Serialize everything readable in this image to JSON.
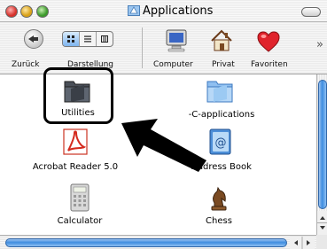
{
  "window": {
    "title": "Applications"
  },
  "toolbar": {
    "back_label": "Zurück",
    "view_label": "Darstellung",
    "computer_label": "Computer",
    "home_label": "Privat",
    "favorites_label": "Favoriten",
    "more_glyph": "»"
  },
  "items": [
    {
      "label": "Utilities",
      "icon": "folder-icon"
    },
    {
      "label": "-C-applications",
      "icon": "folder-icon"
    },
    {
      "label": "Acrobat Reader 5.0",
      "icon": "acrobat-icon"
    },
    {
      "label": "Address Book",
      "icon": "address-book-icon"
    },
    {
      "label": "Calculator",
      "icon": "calculator-icon"
    },
    {
      "label": "Chess",
      "icon": "chess-icon"
    }
  ],
  "colors": {
    "selection_accent": "#3f8de0",
    "highlight_border": "#000000",
    "folder_blue": "#8fbff0"
  }
}
